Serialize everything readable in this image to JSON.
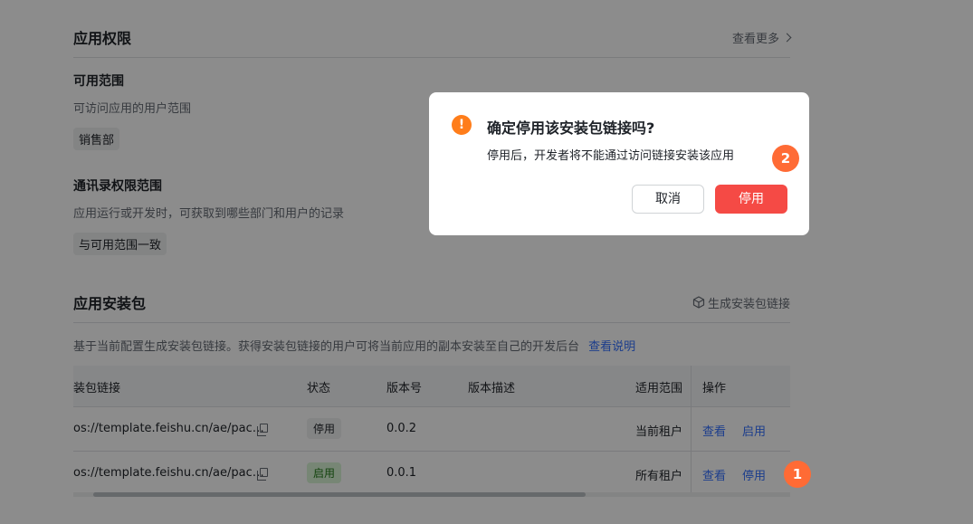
{
  "permissions": {
    "title": "应用权限",
    "more_link": "查看更多",
    "scope": {
      "title": "可用范围",
      "desc": "可访问应用的用户范围",
      "tag": "销售部"
    },
    "contacts": {
      "title": "通讯录权限范围",
      "desc": "应用运行或开发时，可获取到哪些部门和用户的记录",
      "tag": "与可用范围一致"
    }
  },
  "package": {
    "title": "应用安装包",
    "generate_link": "生成安装包链接",
    "desc": "基于当前配置生成安装包链接。获得安装包链接的用户可将当前应用的副本安装至自己的开发后台",
    "help_link": "查看说明",
    "columns": [
      "装包链接",
      "状态",
      "版本号",
      "版本描述",
      "适用范围",
      "操作"
    ],
    "rows": [
      {
        "link": "os://template.feishu.cn/ae/pac…",
        "status": "停用",
        "version": "0.0.2",
        "description": "",
        "scope": "当前租户",
        "action_view": "查看",
        "action_toggle": "启用"
      },
      {
        "link": "os://template.feishu.cn/ae/pac…",
        "status": "启用",
        "version": "0.0.1",
        "description": "",
        "scope": "所有租户",
        "action_view": "查看",
        "action_toggle": "停用"
      }
    ]
  },
  "dialog": {
    "icon": "warning-icon",
    "icon_glyph": "!",
    "title": "确定停用该安装包链接吗?",
    "body": "停用后，开发者将不能通过访问链接安装该应用",
    "cancel_label": "取消",
    "confirm_label": "停用"
  },
  "markers": {
    "first": "1",
    "second": "2"
  },
  "colors": {
    "accent": "#3370ff",
    "danger": "#f54a45",
    "warning": "#ff7d1a",
    "marker": "#ff6b35"
  }
}
